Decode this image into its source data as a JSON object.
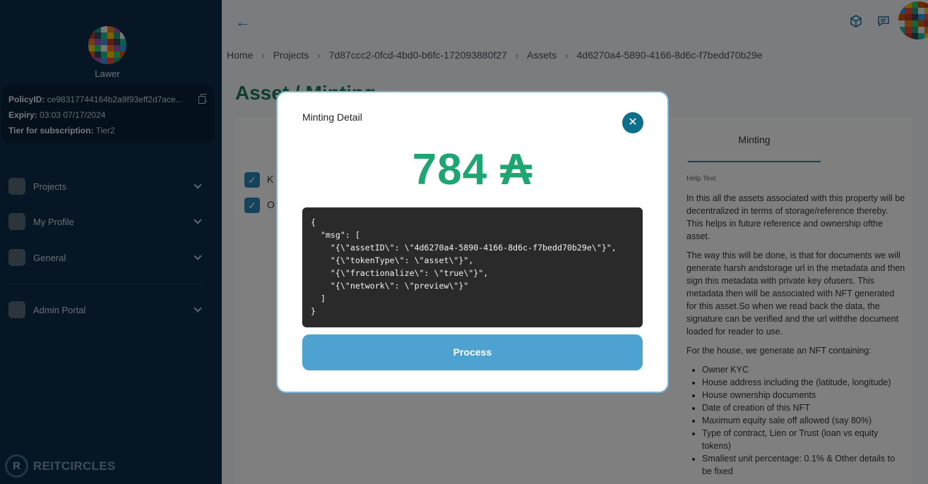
{
  "sidebar": {
    "user_name": "Lawer",
    "policy": {
      "policy_label": "PolicyID:",
      "policy_value": "ce98317744164b2a9f93eff2d7ace...",
      "expiry_label": "Expiry:",
      "expiry_value": "03:03 07/17/2024",
      "tier_label": "Tier for subscription:",
      "tier_value": "Tier2"
    },
    "nav": [
      {
        "label": "Projects"
      },
      {
        "label": "My Profile"
      },
      {
        "label": "General"
      },
      {
        "label": "Admin Portal"
      }
    ],
    "brand": "REITCIRCLES",
    "brand_logo": "R"
  },
  "header": {
    "back_icon": "←",
    "breadcrumb": [
      "Home",
      "Projects",
      "7d87ccc2-0fcd-4bd0-b6fc-172093880f27",
      "Assets",
      "4d6270a4-5890-4166-8d6c-f7bedd70b29e"
    ],
    "separator": "›"
  },
  "page": {
    "title": "Asset / Minting",
    "checkbox_labels": [
      "K",
      "O"
    ],
    "tab_minting": "Minting",
    "help_title": "Help Text",
    "help_paragraphs": [
      "In this all the assets associated with this property will be decentralized in terms of storage/reference thereby. This helps in future reference and ownership ofthe asset.",
      "The way this will be done, is that for documents we will generate harsh andstorage url in the metadata and then sign this metadata with private key ofusers. This metadata then will be associated with NFT generated for this asset.So when we read back the data, the signature can be verified and the url withthe document loaded for reader to use.",
      "For the house, we generate an NFT containing:"
    ],
    "help_list": [
      "Owner KYC",
      "House address including the (latitude, longitude)",
      "House ownership documents",
      "Date of creation of this NFT",
      "Maximum equity sale off allowed (say 80%)",
      "Type of contract, Lien or Trust (loan vs equity tokens)",
      "Smallest unit percentage: 0.1% & Other details to be fixed"
    ]
  },
  "modal": {
    "title": "Minting Detail",
    "close_icon": "✕",
    "amount": "784 ₳",
    "code": "{\n  \"msg\": [\n    \"{\\\"assetID\\\": \\\"4d6270a4-5890-4166-8d6c-f7bedd70b29e\\\"}\",\n    \"{\\\"tokenType\\\": \\\"asset\\\"}\",\n    \"{\\\"fractionalize\\\": \\\"true\\\"}\",\n    \"{\\\"network\\\": \\\"preview\\\"}\"\n  ]\n}",
    "process_label": "Process"
  },
  "colors": {
    "sidebar_bg": "#0c2d48",
    "accent": "#1fa572",
    "button": "#4ea2cf",
    "close_button": "#0e6f8c"
  }
}
